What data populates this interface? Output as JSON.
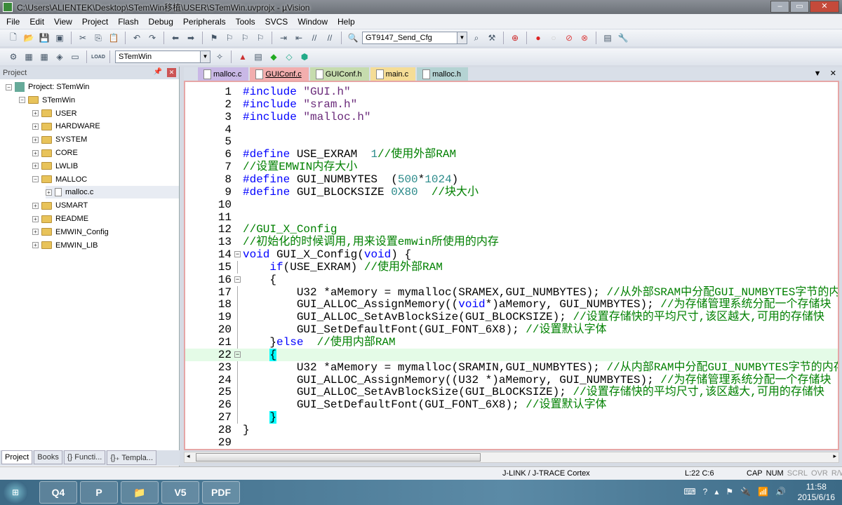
{
  "window": {
    "title": "C:\\Users\\ALIENTEK\\Desktop\\STemWin移植\\USER\\STemWin.uvprojx - µVision",
    "controls": [
      "–",
      "▭",
      "✕"
    ]
  },
  "menu": [
    "File",
    "Edit",
    "View",
    "Project",
    "Flash",
    "Debug",
    "Peripherals",
    "Tools",
    "SVCS",
    "Window",
    "Help"
  ],
  "toolbar": {
    "find_combo": "GT9147_Send_Cfg",
    "target_combo": "STemWin",
    "load_label": "LOAD"
  },
  "project_panel": {
    "title": "Project",
    "tree": [
      {
        "label": "Project: STemWin",
        "level": 0,
        "exp": "−",
        "icon": "project"
      },
      {
        "label": "STemWin",
        "level": 1,
        "exp": "−",
        "icon": "folder"
      },
      {
        "label": "USER",
        "level": 2,
        "exp": "+",
        "icon": "folder"
      },
      {
        "label": "HARDWARE",
        "level": 2,
        "exp": "+",
        "icon": "folder"
      },
      {
        "label": "SYSTEM",
        "level": 2,
        "exp": "+",
        "icon": "folder"
      },
      {
        "label": "CORE",
        "level": 2,
        "exp": "+",
        "icon": "folder"
      },
      {
        "label": "LWLIB",
        "level": 2,
        "exp": "+",
        "icon": "folder"
      },
      {
        "label": "MALLOC",
        "level": 2,
        "exp": "−",
        "icon": "folder"
      },
      {
        "label": "malloc.c",
        "level": 3,
        "exp": "+",
        "icon": "file",
        "selected": true
      },
      {
        "label": "USMART",
        "level": 2,
        "exp": "+",
        "icon": "folder"
      },
      {
        "label": "README",
        "level": 2,
        "exp": "+",
        "icon": "folder"
      },
      {
        "label": "EMWIN_Config",
        "level": 2,
        "exp": "+",
        "icon": "folder"
      },
      {
        "label": "EMWIN_LIB",
        "level": 2,
        "exp": "+",
        "icon": "folder"
      }
    ],
    "tabs": [
      {
        "label": "Project",
        "active": true
      },
      {
        "label": "Books"
      },
      {
        "label": "{} Functi..."
      },
      {
        "label": "{}₊ Templa..."
      }
    ]
  },
  "editor": {
    "tabs": [
      {
        "label": "malloc.c",
        "color": "#c9b8e6"
      },
      {
        "label": "GUIConf.c",
        "color": "#f2aeae",
        "active": true
      },
      {
        "label": "GUIConf.h",
        "color": "#c6dcae"
      },
      {
        "label": "main.c",
        "color": "#f5dd96"
      },
      {
        "label": "malloc.h",
        "color": "#b4d3d3"
      }
    ],
    "current_line": 22,
    "lines": [
      [
        [
          "#include ",
          "k"
        ],
        [
          "\"GUI.h\"",
          "s"
        ]
      ],
      [
        [
          "#include ",
          "k"
        ],
        [
          "\"sram.h\"",
          "s"
        ]
      ],
      [
        [
          "#include ",
          "k"
        ],
        [
          "\"malloc.h\"",
          "s"
        ]
      ],
      [],
      [],
      [
        [
          "#define ",
          "k"
        ],
        [
          "USE_EXRAM  ",
          "p"
        ],
        [
          "1",
          "n"
        ],
        [
          "//使用外部RAM",
          "c"
        ]
      ],
      [
        [
          "//设置EMWIN内存大小",
          "c"
        ]
      ],
      [
        [
          "#define ",
          "k"
        ],
        [
          "GUI_NUMBYTES  ",
          "p"
        ],
        [
          "(",
          "p"
        ],
        [
          "500",
          "n"
        ],
        [
          "*",
          "p"
        ],
        [
          "1024",
          "n"
        ],
        [
          ")",
          "p"
        ]
      ],
      [
        [
          "#define ",
          "k"
        ],
        [
          "GUI_BLOCKSIZE ",
          "p"
        ],
        [
          "0X80",
          "n"
        ],
        [
          "  //块大小",
          "c"
        ]
      ],
      [],
      [],
      [
        [
          "//GUI_X_Config",
          "c"
        ]
      ],
      [
        [
          "//初始化的时候调用,用来设置emwin所使用的内存",
          "c"
        ]
      ],
      [
        [
          "void ",
          "k"
        ],
        [
          "GUI_X_Config(",
          "p"
        ],
        [
          "void",
          "k"
        ],
        [
          ") {",
          "p"
        ]
      ],
      [
        [
          "    ",
          "p"
        ],
        [
          "if",
          "k"
        ],
        [
          "(USE_EXRAM) ",
          "p"
        ],
        [
          "//使用外部RAM",
          "c"
        ]
      ],
      [
        [
          "    {",
          "p"
        ]
      ],
      [
        [
          "        U32 *aMemory = mymalloc(SRAMEX,GUI_NUMBYTES); ",
          "p"
        ],
        [
          "//从外部SRAM中分配GUI_NUMBYTES字节的内存",
          "c"
        ]
      ],
      [
        [
          "        GUI_ALLOC_AssignMemory((",
          "p"
        ],
        [
          "void",
          "k"
        ],
        [
          "*)aMemory, GUI_NUMBYTES); ",
          "p"
        ],
        [
          "//为存储管理系统分配一个存储块",
          "c"
        ]
      ],
      [
        [
          "        GUI_ALLOC_SetAvBlockSize(GUI_BLOCKSIZE); ",
          "p"
        ],
        [
          "//设置存储快的平均尺寸,该区越大,可用的存储快",
          "c"
        ]
      ],
      [
        [
          "        GUI_SetDefaultFont(GUI_FONT_6X8); ",
          "p"
        ],
        [
          "//设置默认字体",
          "c"
        ]
      ],
      [
        [
          "    }",
          "p"
        ],
        [
          "else",
          "k"
        ],
        [
          "  //使用内部RAM",
          "c"
        ]
      ],
      [
        [
          "    ",
          "p"
        ],
        [
          "{",
          "b"
        ]
      ],
      [
        [
          "        U32 *aMemory = mymalloc(SRAMIN,GUI_NUMBYTES); ",
          "p"
        ],
        [
          "//从内部RAM中分配GUI_NUMBYTES字节的内存",
          "c"
        ]
      ],
      [
        [
          "        GUI_ALLOC_AssignMemory((U32 *)aMemory, GUI_NUMBYTES); ",
          "p"
        ],
        [
          "//为存储管理系统分配一个存储块",
          "c"
        ]
      ],
      [
        [
          "        GUI_ALLOC_SetAvBlockSize(GUI_BLOCKSIZE); ",
          "p"
        ],
        [
          "//设置存储快的平均尺寸,该区越大,可用的存储快",
          "c"
        ]
      ],
      [
        [
          "        GUI_SetDefaultFont(GUI_FONT_6X8); ",
          "p"
        ],
        [
          "//设置默认字体",
          "c"
        ]
      ],
      [
        [
          "    ",
          "p"
        ],
        [
          "}",
          "b"
        ]
      ],
      [
        [
          "}",
          "p"
        ]
      ],
      []
    ],
    "fold_markers": {
      "14": "−",
      "16": "−",
      "22": "−"
    }
  },
  "status": {
    "debugger": "J-LINK / J-TRACE Cortex",
    "position": "L:22 C:6",
    "flags": [
      {
        "t": "CAP",
        "on": true
      },
      {
        "t": "NUM",
        "on": true
      },
      {
        "t": "SCRL",
        "on": false
      },
      {
        "t": "OVR",
        "on": false
      },
      {
        "t": "R/W",
        "on": false
      }
    ]
  },
  "taskbar": {
    "time": "11:58",
    "date": "2015/6/16",
    "apps": [
      "Q4",
      "P",
      "📁",
      "V5",
      "PDF"
    ]
  }
}
